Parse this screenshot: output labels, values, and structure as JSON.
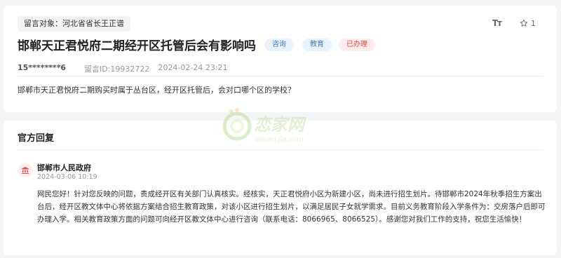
{
  "post": {
    "target_label": "留言对象：河北省省长王正谱",
    "title": "邯郸天正君悦府二期经开区托管后会有影响吗",
    "tags": [
      "咨询",
      "教育",
      "已办理"
    ],
    "user_id": "15********6",
    "message_id": "留言ID:19932722",
    "date": "2024-02-24 23:21",
    "body": "邯郸市天正君悦府二期购买时属于丛台区，经开区托管后，会对口哪个区的学校？"
  },
  "toolbar": {
    "font_icon": "font-size-icon",
    "font_glyph": "Tт",
    "like_icon": "star-icon",
    "like_count": "1"
  },
  "reply": {
    "heading": "官方回复",
    "department": "邯郸市人民政府",
    "time": "2024-03-06 10:19",
    "content": "网民您好！针对您反映的问题，责成经开区有关部门认真核实。经核实，天正君悦府小区为新建小区，尚未进行招生划片。待邯郸市2024年秋季招生方案出台后，经开区教文体中心将依据方案结合招生教育政策，对该小区进行招生划片，以满足居民子女就学需求。目前义务教育阶段入学条件为：交房落户后即可办理入学。相关教育政策方面的问题可向经开区教文体中心进行咨询（联系电话：8066965、8066525）。感谢您对我们工作的支持，祝您生活愉快！"
  },
  "watermark": {
    "brand": "恋家网",
    "url": "www.Ljia.com"
  },
  "colors": {
    "accent_blue": "#3f7dc0",
    "accent_red": "#e0483e",
    "badge_blue_bg": "#eaf3fb",
    "badge_red_bg": "#fdeced"
  }
}
